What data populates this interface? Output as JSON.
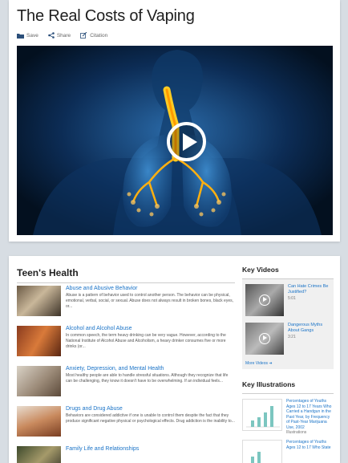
{
  "article": {
    "title": "The Real Costs of Vaping",
    "actions": {
      "save": "Save",
      "share": "Share",
      "citation": "Citation"
    }
  },
  "topic": {
    "heading": "Teen's Health",
    "items": [
      {
        "title": "Abuse and Abusive Behavior",
        "desc": "Abuse is a pattern of behavior used to control another person. The behavior can be physical, emotional, verbal, social, or sexual. Abuse does not always result in broken bones, black eyes, or..."
      },
      {
        "title": "Alcohol and Alcohol Abuse",
        "desc": "In common speech, the term heavy drinking can be very vague. However, according to the National Institute of Alcohol Abuse and Alcoholism, a heavy drinker consumes five or more drinks (or..."
      },
      {
        "title": "Anxiety, Depression, and Mental Health",
        "desc": "Most healthy people are able to handle stressful situations. Although they recognize that life can be challenging, they know it doesn't have to be overwhelming. If an individual feels..."
      },
      {
        "title": "Drugs and Drug Abuse",
        "desc": "Behaviors are considered addictive if one is unable to control them despite the fact that they produce significant negative physical or psychological effects. Drug addiction is the inability to..."
      },
      {
        "title": "Family Life and Relationships",
        "desc": ""
      }
    ]
  },
  "key_videos": {
    "heading": "Key Videos",
    "items": [
      {
        "title": "Can Hate Crimes Be Justified?",
        "duration": "5:01"
      },
      {
        "title": "Dangerous Myths About Gangs",
        "duration": "3:21"
      }
    ],
    "more": "More Videos ➜"
  },
  "key_illustrations": {
    "heading": "Key Illustrations",
    "items": [
      {
        "title": "Percentages of Youths Ages 12 to 17 Years Who Carried a Handgun in the Past Year, by Frequency of Past-Year Marijuana Use, 2002",
        "type": "Illustrations"
      },
      {
        "title": "Percentages of Youths Ages 12 to 17 Who State",
        "type": ""
      }
    ]
  }
}
